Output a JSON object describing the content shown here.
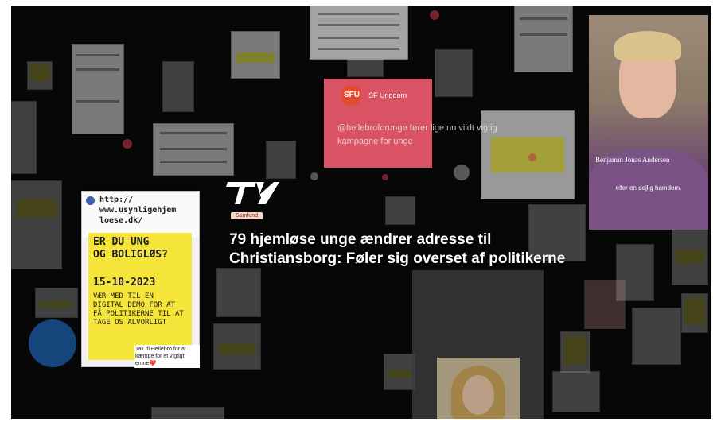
{
  "brand": {
    "logo": "TV2"
  },
  "article": {
    "category": "Samfund",
    "headline": "79 hjemløse unge ændrer adresse til Christiansborg: Føler sig overset af politikerne"
  },
  "poster": {
    "url": "http:// www.usynligehjem loese.dk/",
    "title_line1": "ER DU UNG",
    "title_line2": "OG BOLIGLØS?",
    "date": "15-10-2023",
    "body": "VÆR MED TIL EN DIGITAL DEMO FOR AT FÅ POLITIKERNE TIL AT TAGE OS ALVORLIGT",
    "url_tail": "www.usyn",
    "caption": "Tak til Hellebro for at kæmpe for et vigtigt emne❤️"
  },
  "sfu": {
    "logo": "SFU",
    "name": "SF Ungdom",
    "quote": "@hellebroforunge fører lige nu vildt vigtig kampagne for unge"
  },
  "interview": {
    "name": "Benjamin Jonas Andersen",
    "subtitle": "eller en dejlig hamdom."
  },
  "colors": {
    "background": "#070707",
    "poster_yellow": "#f5e43a",
    "sfu_red": "#d95365",
    "headline": "#ffffff"
  }
}
